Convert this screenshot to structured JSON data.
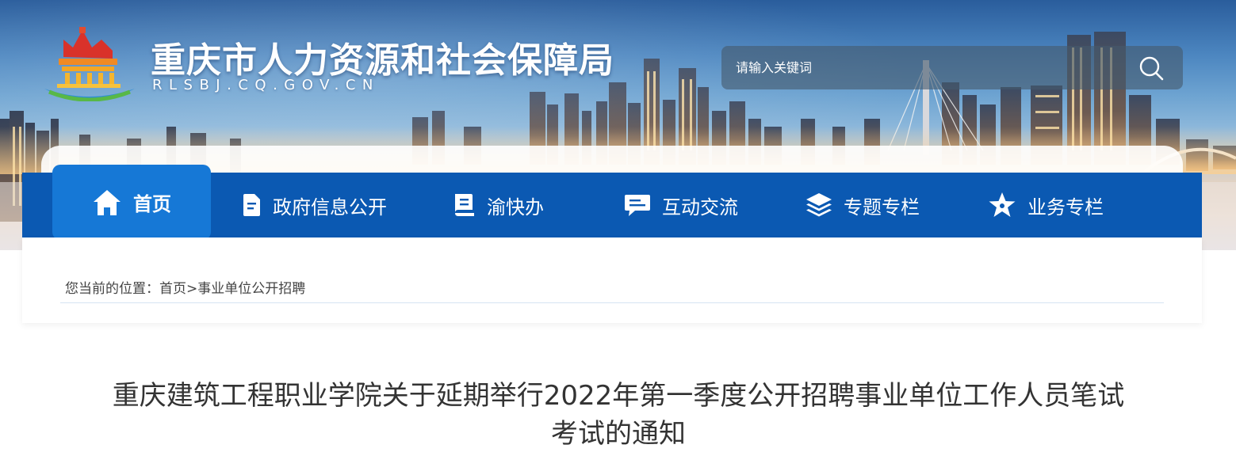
{
  "header": {
    "site_title": "重庆市人力资源和社会保障局",
    "site_domain": "RLSBJ.CQ.GOV.CN",
    "logo_icon": "emblem-logo-icon"
  },
  "search": {
    "placeholder": "请输入关键词",
    "icon": "search-icon"
  },
  "nav": {
    "items": [
      {
        "label": "首页",
        "icon": "home-icon",
        "active": true
      },
      {
        "label": "政府信息公开",
        "icon": "document-icon",
        "active": false
      },
      {
        "label": "渝快办",
        "icon": "book-icon",
        "active": false
      },
      {
        "label": "互动交流",
        "icon": "chat-icon",
        "active": false
      },
      {
        "label": "专题专栏",
        "icon": "layers-icon",
        "active": false
      },
      {
        "label": "业务专栏",
        "icon": "star-icon",
        "active": false
      }
    ]
  },
  "breadcrumb": {
    "prefix": "您当前的位置：",
    "home": "首页",
    "separator": ">",
    "current": "事业单位公开招聘"
  },
  "article": {
    "title_line1": "重庆建筑工程职业学院关于延期举行2022年第一季度公开招聘事业单位工作人员笔试",
    "title_line2": "考试的通知"
  },
  "colors": {
    "nav_bg": "#0b59b2",
    "nav_active": "#1678d6",
    "text": "#333333"
  }
}
